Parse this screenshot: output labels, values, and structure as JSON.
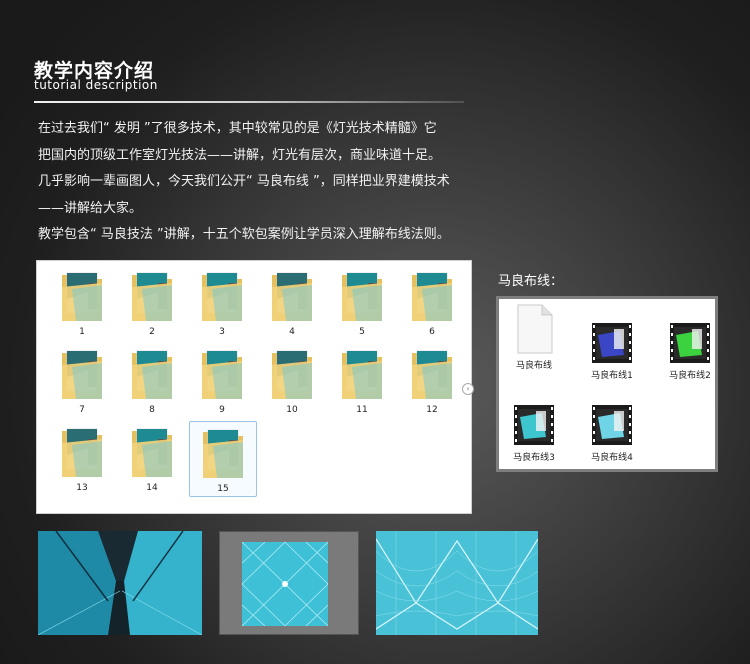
{
  "header": {
    "title_cn": "教学内容介绍",
    "title_en": "tutorial  description"
  },
  "intro": {
    "lines": [
      "在过去我们“ 发明 ”了很多技术，其中较常见的是《灯光技术精髓》它",
      "把国内的顶级工作室灯光技法——讲解，灯光有层次，商业味道十足。",
      "几乎影响一辈画图人，今天我们公开“ 马良布线 ”，同样把业界建模技术",
      "——讲解给大家。",
      "教学包含“ 马良技法 ”讲解，十五个软包案例让学员深入理解布线法则。"
    ]
  },
  "explorer": {
    "folders": [
      "1",
      "2",
      "3",
      "4",
      "5",
      "6",
      "7",
      "8",
      "9",
      "10",
      "11",
      "12",
      "13",
      "14",
      "15"
    ],
    "selected": "15"
  },
  "malian": {
    "label": "马良布线：",
    "files": [
      {
        "name": "马良布线",
        "kind": "document"
      },
      {
        "name": "马良布线1",
        "kind": "video"
      },
      {
        "name": "马良布线2",
        "kind": "video"
      },
      {
        "name": "马良布线3",
        "kind": "video"
      },
      {
        "name": "马良布线4",
        "kind": "video"
      }
    ]
  },
  "colors": {
    "folder_yellow": "#f2d27a",
    "folder_teal": "#7cc9cf",
    "accent_cyan": "#3fb7cf"
  }
}
